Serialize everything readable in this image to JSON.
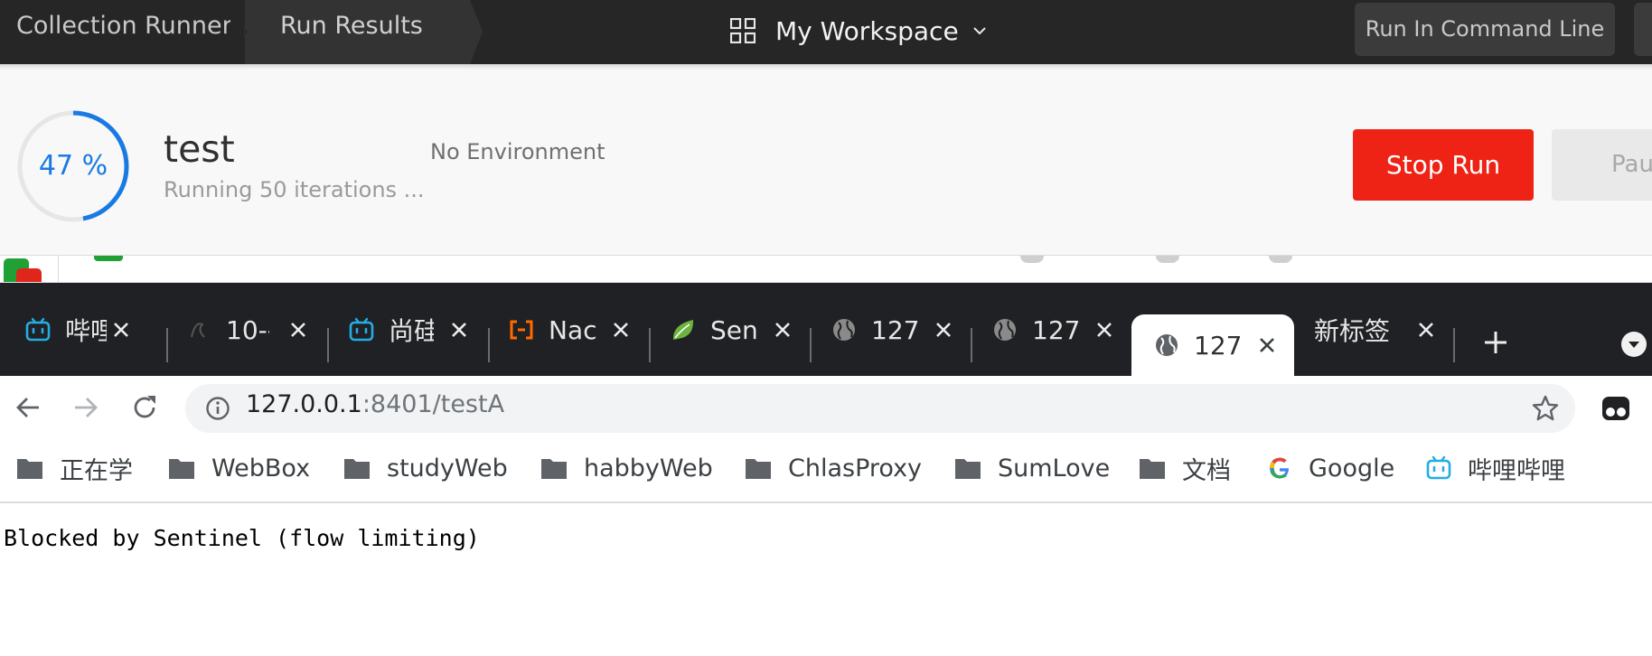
{
  "postman": {
    "breadcrumbs": [
      "Collection Runner",
      "Run Results"
    ],
    "workspace_label": "My Workspace",
    "command_line_button": "Run In Command Line",
    "run": {
      "progress_text": "47 %",
      "progress_fraction": 0.47,
      "name": "test",
      "status": "Running 50 iterations ...",
      "environment": "No Environment",
      "stop_label": "Stop Run",
      "pause_label": "Pause"
    },
    "colors": {
      "accent": "#1a7ae3",
      "stop": "#ef2216",
      "topbar": "#262626"
    }
  },
  "browser": {
    "tabs": [
      {
        "title": "哔哩",
        "icon": "bilibili-icon"
      },
      {
        "title": "10--",
        "icon": "generic-page-icon"
      },
      {
        "title": "尚硅",
        "icon": "bilibili-icon"
      },
      {
        "title": "Nac",
        "icon": "alibaba-cloud-icon"
      },
      {
        "title": "Sen",
        "icon": "spring-leaf-icon"
      },
      {
        "title": "127",
        "icon": "globe-icon"
      },
      {
        "title": "127",
        "icon": "globe-icon"
      },
      {
        "title": "127",
        "icon": "globe-icon",
        "active": true
      },
      {
        "title": "新标签",
        "icon": "none"
      }
    ],
    "url_host": "127.0.0.1",
    "url_rest": ":8401/testA",
    "bookmarks": [
      {
        "label": "正在学",
        "icon": "folder-icon"
      },
      {
        "label": "WebBox",
        "icon": "folder-icon"
      },
      {
        "label": "studyWeb",
        "icon": "folder-icon"
      },
      {
        "label": "habbyWeb",
        "icon": "folder-icon"
      },
      {
        "label": "ChlasProxy",
        "icon": "folder-icon"
      },
      {
        "label": "SumLove",
        "icon": "folder-icon"
      },
      {
        "label": "文档",
        "icon": "folder-icon"
      },
      {
        "label": "Google",
        "icon": "google-icon"
      },
      {
        "label": "哔哩哔哩",
        "icon": "bilibili-icon"
      }
    ]
  },
  "page": {
    "body_text": "Blocked by Sentinel (flow limiting)"
  }
}
